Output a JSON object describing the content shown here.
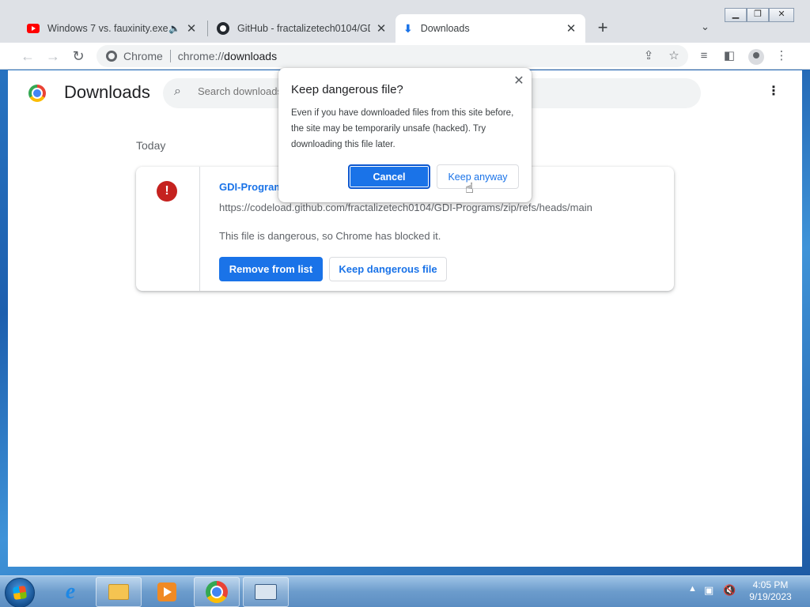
{
  "tabs": [
    {
      "title": "Windows 7 vs. fauxinity.exe -",
      "icon": "youtube-icon",
      "audio": "🔈"
    },
    {
      "title": "GitHub - fractalizetech0104/GDI-",
      "icon": "github-icon"
    },
    {
      "title": "Downloads",
      "icon": "download-icon"
    }
  ],
  "toolbar": {
    "omni_label": "Chrome",
    "omni_scheme": "chrome://",
    "omni_host": "downloads"
  },
  "downloads_page": {
    "title": "Downloads",
    "search_placeholder": "Search downloads",
    "date_header": "Today",
    "item": {
      "file_name": "GDI-Programs-main.zip",
      "url": "https://codeload.github.com/fractalizetech0104/GDI-Programs/zip/refs/heads/main",
      "status": "This file is dangerous, so Chrome has blocked it.",
      "remove_label": "Remove from list",
      "keep_label": "Keep dangerous file"
    }
  },
  "dialog": {
    "title": "Keep dangerous file?",
    "body": "Even if you have downloaded files from this site before, the site may be temporarily unsafe (hacked). Try downloading this file later.",
    "cancel_label": "Cancel",
    "keep_label": "Keep anyway"
  },
  "taskbar": {
    "time": "4:05 PM",
    "date": "9/19/2023"
  },
  "colors": {
    "accent": "#1a73e8",
    "danger": "#c5221f"
  }
}
